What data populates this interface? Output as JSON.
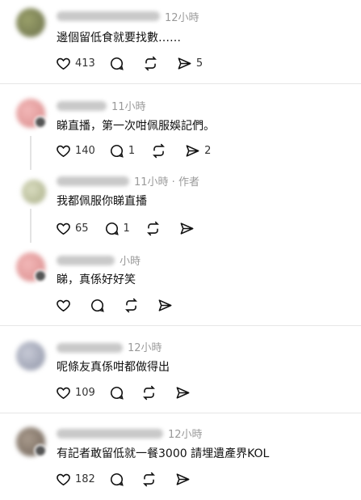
{
  "comments": [
    {
      "time": "12小時",
      "body": "邊個留低食就要找數……",
      "likes": "413",
      "replies": "",
      "reposts": "",
      "shares": "5"
    },
    {
      "time": "11小時",
      "body": "睇直播，第一次咁佩服娛記們。",
      "likes": "140",
      "replies": "1",
      "reposts": "",
      "shares": "2"
    },
    {
      "time": "11小時 · 作者",
      "body": "我都佩服你睇直播",
      "likes": "65",
      "replies": "1",
      "reposts": "",
      "shares": ""
    },
    {
      "time": "小時",
      "body": "睇，真係好好笑",
      "likes": "",
      "replies": "",
      "reposts": "",
      "shares": ""
    },
    {
      "time": "12小時",
      "body": "呢條友真係咁都做得出",
      "likes": "109",
      "replies": "",
      "reposts": "",
      "shares": ""
    },
    {
      "time": "12小時",
      "body": "有記者敢留低就一餐3000 請埋遺產界KOL",
      "likes": "182",
      "replies": "",
      "reposts": "",
      "shares": ""
    }
  ],
  "icons": {
    "like": "heart-icon",
    "reply": "comment-bubble-icon",
    "repost": "repost-arrows-icon",
    "share": "send-icon"
  }
}
